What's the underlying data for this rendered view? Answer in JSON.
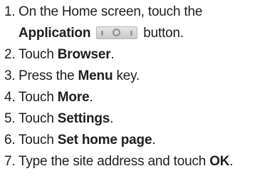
{
  "steps": [
    {
      "num": "1.",
      "pre": "On the Home screen, touch the",
      "bold": "Application",
      "icon": "application-button-icon",
      "post": "button."
    },
    {
      "num": "2.",
      "pre": "Touch ",
      "bold": "Browser",
      "post": "."
    },
    {
      "num": "3.",
      "pre": "Press the ",
      "bold": "Menu",
      "post": " key."
    },
    {
      "num": "4.",
      "pre": "Touch ",
      "bold": "More",
      "post": "."
    },
    {
      "num": "5.",
      "pre": "Touch ",
      "bold": "Settings",
      "post": "."
    },
    {
      "num": "6.",
      "pre": "Touch ",
      "bold": "Set home page",
      "post": "."
    },
    {
      "num": "7.",
      "pre": "Type the site address and touch ",
      "bold": "OK",
      "post": "."
    }
  ]
}
